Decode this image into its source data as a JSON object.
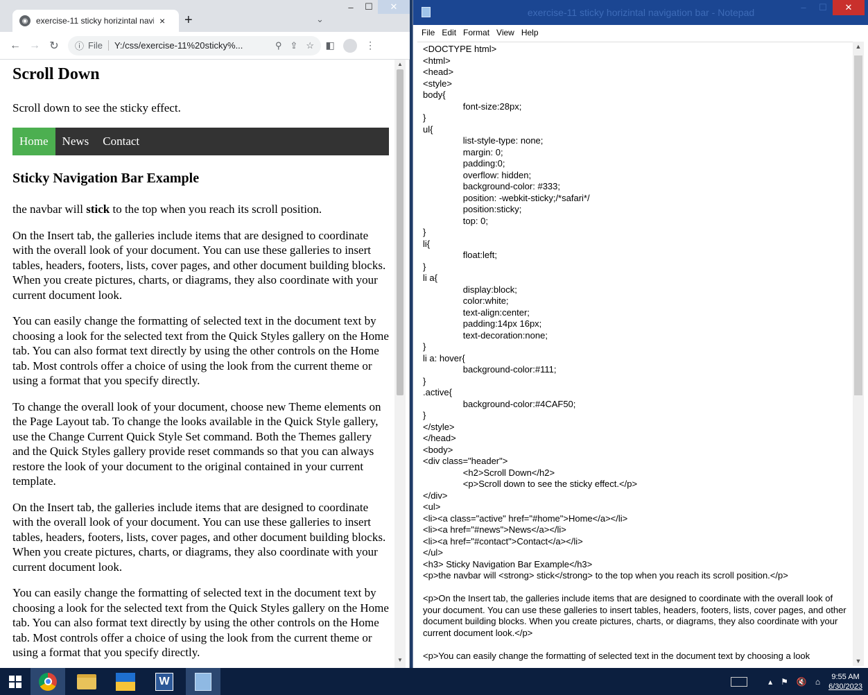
{
  "chrome": {
    "tab_title": "exercise-11 sticky horizintal navig",
    "tab_close": "×",
    "new_tab": "+",
    "tab_search": "⌄",
    "address_scheme": "File",
    "address_url": "Y:/css/exercise-11%20sticky%...",
    "page": {
      "heading": "Scroll Down",
      "lead": "Scroll down to see the sticky effect.",
      "nav_items": [
        "Home",
        "News",
        "Contact"
      ],
      "section_title": "Sticky Navigation Bar Example",
      "sticky_sentence_before": "the navbar will ",
      "sticky_sentence_strong": "stick",
      "sticky_sentence_after": " to the top when you reach its scroll position.",
      "paragraphs": [
        "On the Insert tab, the galleries include items that are designed to coordinate with the overall look of your document. You can use these galleries to insert tables, headers, footers, lists, cover pages, and other document building blocks. When you create pictures, charts, or diagrams, they also coordinate with your current document look.",
        "You can easily change the formatting of selected text in the document text by choosing a look for the selected text from the Quick Styles gallery on the Home tab. You can also format text directly by using the other controls on the Home tab. Most controls offer a choice of using the look from the current theme or using a format that you specify directly.",
        "To change the overall look of your document, choose new Theme elements on the Page Layout tab. To change the looks available in the Quick Style gallery, use the Change Current Quick Style Set command. Both the Themes gallery and the Quick Styles gallery provide reset commands so that you can always restore the look of your document to the original contained in your current template.",
        "On the Insert tab, the galleries include items that are designed to coordinate with the overall look of your document. You can use these galleries to insert tables, headers, footers, lists, cover pages, and other document building blocks. When you create pictures, charts, or diagrams, they also coordinate with your current document look.",
        "You can easily change the formatting of selected text in the document text by choosing a look for the selected text from the Quick Styles gallery on the Home tab. You can also format text directly by using the other controls on the Home tab. Most controls offer a choice of using the look from the current theme or using a format that you specify directly."
      ]
    }
  },
  "notepad": {
    "title": "exercise-11 sticky horizintal navigation bar - Notepad",
    "menu": [
      "File",
      "Edit",
      "Format",
      "View",
      "Help"
    ],
    "content": "<DOCTYPE html>\n<html>\n<head>\n<style>\nbody{\n\t\tfont-size:28px;\n}\nul{\n\t\tlist-style-type: none;\n\t\tmargin: 0;\n\t\tpadding:0;\n\t\toverflow: hidden;\n\t\tbackground-color: #333;\n\t\tposition: -webkit-sticky;/*safari*/\n\t\tposition:sticky;\n\t\ttop: 0;\n}\nli{\n\t\tfloat:left;\n}\nli a{\n\t\tdisplay:block;\n\t\tcolor:white;\n\t\ttext-align:center;\n\t\tpadding:14px 16px;\n\t\ttext-decoration:none;\n}\nli a: hover{\n\t\tbackground-color:#111;\n}\n.active{\n\t\tbackground-color:#4CAF50;\n}\n</style>\n</head>\n<body>\n<div class=\"header\">\n\t\t<h2>Scroll Down</h2>\n\t\t<p>Scroll down to see the sticky effect.</p>\n</div>\n<ul>\n<li><a class=\"active\" href=\"#home\">Home</a></li>\n<li><a href=\"#news\">News</a></li>\n<li><a href=\"#contact\">Contact</a></li>\n</ul>\n<h3> Sticky Navigation Bar Example</h3>\n<p>the navbar will <strong> stick</strong> to the top when you reach its scroll position.</p>\n\n<p>On the Insert tab, the galleries include items that are designed to coordinate with the overall look of your document. You can use these galleries to insert tables, headers, footers, lists, cover pages, and other document building blocks. When you create pictures, charts, or diagrams, they also coordinate with your current document look.</p>\n\n<p>You can easily change the formatting of selected text in the document text by choosing a look"
  },
  "taskbar": {
    "time": "9:55 AM",
    "date": "6/30/2023"
  },
  "colors": {
    "navbar_bg": "#333333",
    "active_bg": "#4CAF50",
    "notepad_titlebar": "#1b4692",
    "taskbar_bg": "#0c1f3f"
  }
}
